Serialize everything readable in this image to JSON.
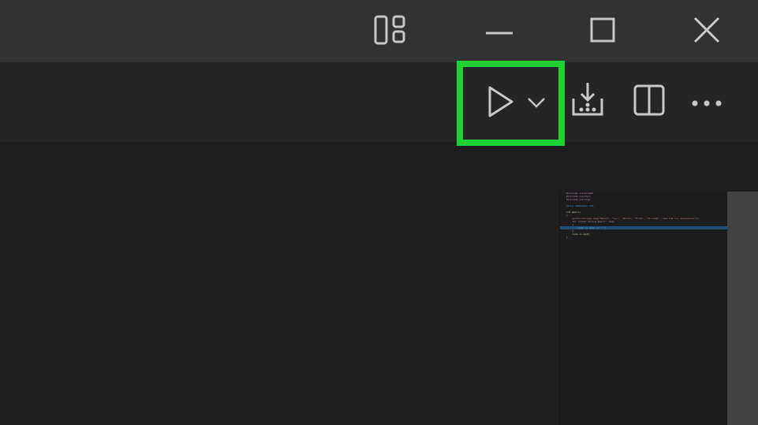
{
  "titlebar": {
    "icons": [
      "layout-icon",
      "minimize-icon",
      "maximize-icon",
      "close-icon"
    ]
  },
  "toolbar": {
    "icons": [
      "run-icon",
      "run-dropdown-chevron-icon",
      "download-icon",
      "split-editor-icon",
      "more-actions-icon"
    ]
  },
  "highlight_color": "#1ed233",
  "minimap": {
    "lines": [
      "#include <iostream>",
      "#include <vector>",
      "#include <string>",
      "",
      "using namespace std;",
      "",
      "int main()",
      "{",
      "    vector<string> msg{\"Hello\", \"C++\", \"World\", \"from\", \"VS Code\", \"and the C++ extension!\"};",
      "    for (const string &word : msg)",
      "    {",
      "        cout << word << \" \";",
      "    }",
      "    cout << endl;",
      "}"
    ],
    "current_line": 11
  }
}
